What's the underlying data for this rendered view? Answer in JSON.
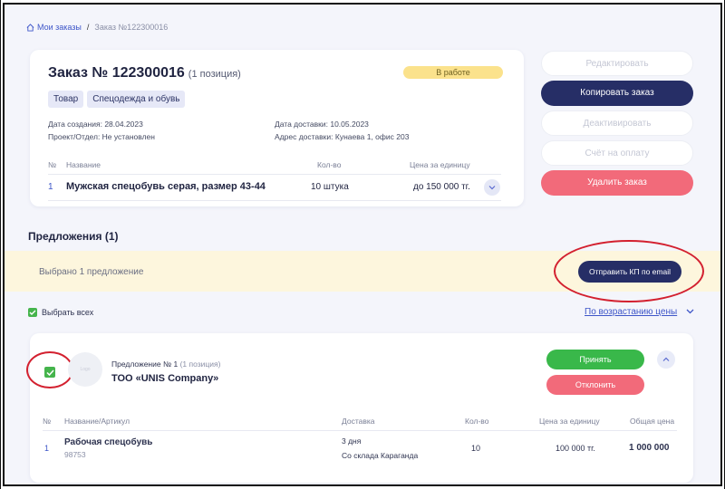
{
  "breadcrumb": {
    "home": "Мои заказы",
    "separator": "/",
    "current": "Заказ №122300016"
  },
  "order": {
    "title": "Заказ № 122300016",
    "positions": "(1 позиция)",
    "status": "В работе",
    "tags": [
      "Товар",
      "Спецодежда и обувь"
    ],
    "created": "Дата создания: 28.04.2023",
    "project": "Проект/Отдел: Не установлен",
    "delivery_date": "Дата доставки: 10.05.2023",
    "delivery_address": "Адрес доставки: Кунаева 1, офис 203",
    "columns": {
      "num": "№",
      "name": "Название",
      "qty": "Кол-во",
      "price": "Цена за единицу"
    },
    "row": {
      "num": "1",
      "name": "Мужская спецобувь серая, размер 43-44",
      "qty": "10 штука",
      "price": "до 150 000 тг."
    }
  },
  "actions": {
    "edit": "Редактировать",
    "copy": "Копировать заказ",
    "deactivate": "Деактивировать",
    "invoice": "Счёт на оплату",
    "delete": "Удалить заказ"
  },
  "offers": {
    "title": "Предложения (1)",
    "selected_text": "Выбрано 1 предложение",
    "send_email": "Отправить КП по email",
    "select_all": "Выбрать всех",
    "sort": "По возрастанию цены"
  },
  "offer": {
    "logo_text": "Logo",
    "label": "Предложение № 1",
    "positions": "(1 позиция)",
    "company": "ТОО «UNIS Company»",
    "accept": "Принять",
    "reject": "Отклонить",
    "columns": {
      "num": "№",
      "name": "Название/Артикул",
      "delivery": "Доставка",
      "qty": "Кол-во",
      "unit_price": "Цена за единицу",
      "total": "Общая цена"
    },
    "row": {
      "num": "1",
      "name": "Рабочая спецобувь",
      "sku": "98753",
      "delivery_days": "3 дня",
      "delivery_from": "Со склада Караганда",
      "qty": "10",
      "unit_price": "100 000 тг.",
      "total": "1 000 000"
    }
  },
  "colors": {
    "navy": "#262e66",
    "green": "#39b84a",
    "red": "#f26a7a",
    "status_yellow": "#fbe28c",
    "annotation_red": "#d3202f"
  }
}
